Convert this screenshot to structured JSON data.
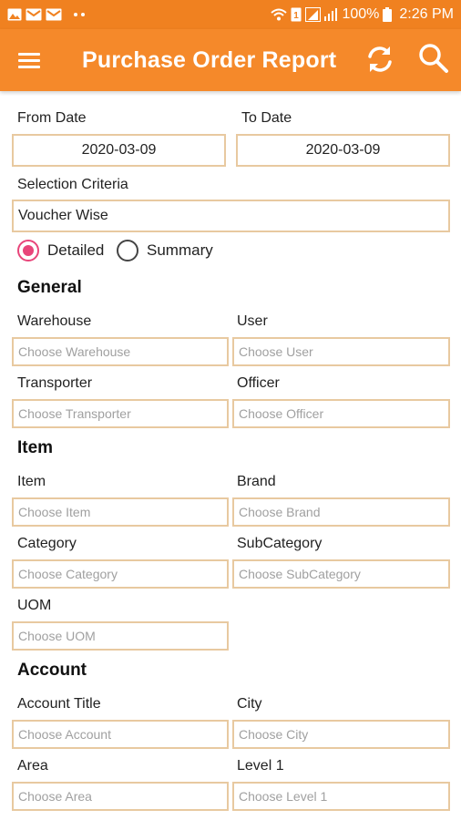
{
  "status_bar": {
    "time": "2:26 PM",
    "battery": "100%",
    "left_icons": [
      "image-icon",
      "email-icon",
      "email-icon",
      "more-dots-icon"
    ],
    "right_icons": [
      "wifi-icon",
      "signal-icon",
      "battery-icon"
    ]
  },
  "appbar": {
    "title": "Purchase Order Report",
    "color": "#f5892a"
  },
  "dates": {
    "from_label": "From Date",
    "from_value": "2020-03-09",
    "to_label": "To Date",
    "to_value": "2020-03-09"
  },
  "selection": {
    "label": "Selection Criteria",
    "value": "Voucher Wise"
  },
  "report_type": {
    "detailed": "Detailed",
    "summary": "Summary",
    "selected": "Detailed",
    "accent": "#e8457a"
  },
  "general": {
    "title": "General",
    "warehouse_label": "Warehouse",
    "warehouse_placeholder": "Choose Warehouse",
    "user_label": "User",
    "user_placeholder": "Choose User",
    "transporter_label": "Transporter",
    "transporter_placeholder": "Choose Transporter",
    "officer_label": "Officer",
    "officer_placeholder": "Choose Officer"
  },
  "item": {
    "title": "Item",
    "item_label": "Item",
    "item_placeholder": "Choose Item",
    "brand_label": "Brand",
    "brand_placeholder": "Choose Brand",
    "category_label": "Category",
    "category_placeholder": "Choose Category",
    "subcategory_label": "SubCategory",
    "subcategory_placeholder": "Choose SubCategory",
    "uom_label": "UOM",
    "uom_placeholder": "Choose UOM"
  },
  "account": {
    "title": "Account",
    "account_label": "Account Title",
    "account_placeholder": "Choose Account",
    "city_label": "City",
    "city_placeholder": "Choose City",
    "area_label": "Area",
    "area_placeholder": "Choose Area",
    "level1_label": "Level 1",
    "level1_placeholder": "Choose Level 1"
  }
}
